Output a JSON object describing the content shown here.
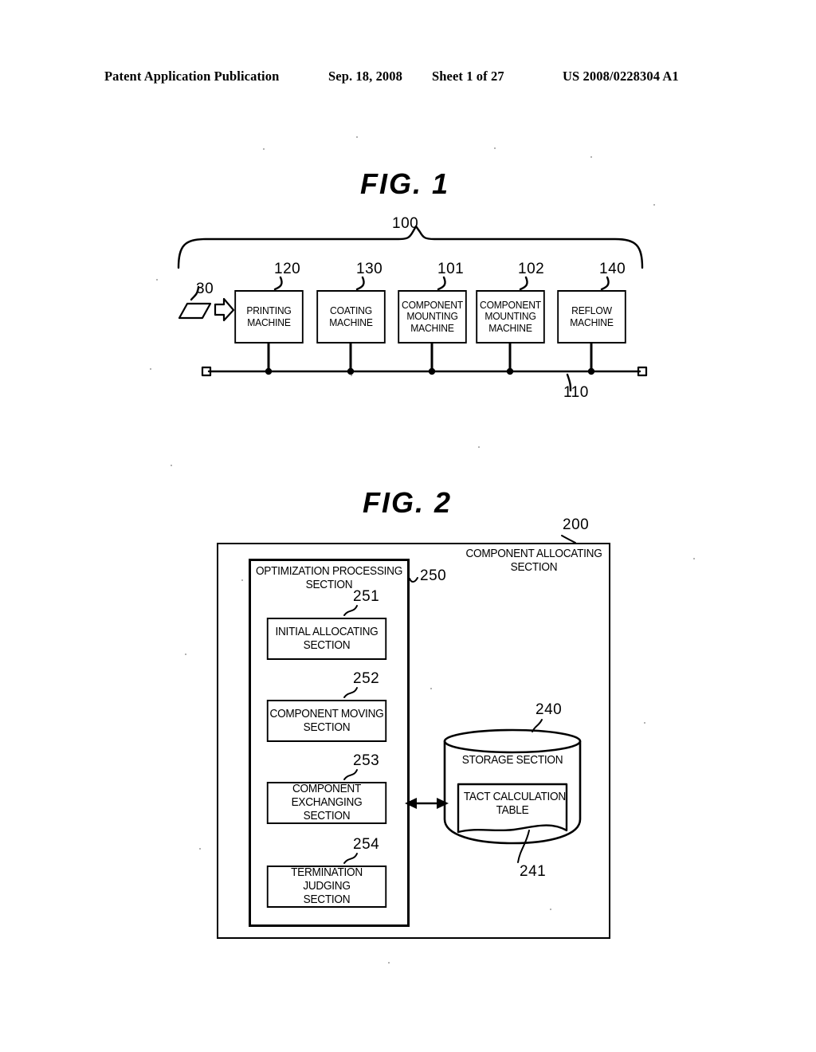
{
  "header": {
    "publication": "Patent Application Publication",
    "date": "Sep. 18, 2008",
    "sheet": "Sheet 1 of 27",
    "patent_number": "US 2008/0228304 A1"
  },
  "figures": [
    {
      "title": "FIG. 1",
      "system_ref": "100",
      "bus_ref": "110",
      "board_ref": "30",
      "machines": [
        {
          "ref": "120",
          "lines": [
            "PRINTING",
            "MACHINE"
          ]
        },
        {
          "ref": "130",
          "lines": [
            "COATING",
            "MACHINE"
          ]
        },
        {
          "ref": "101",
          "lines": [
            "COMPONENT",
            "MOUNTING",
            "MACHINE"
          ]
        },
        {
          "ref": "102",
          "lines": [
            "COMPONENT",
            "MOUNTING",
            "MACHINE"
          ]
        },
        {
          "ref": "140",
          "lines": [
            "REFLOW",
            "MACHINE"
          ]
        }
      ]
    },
    {
      "title": "FIG. 2",
      "outer": {
        "ref": "200",
        "lines": [
          "COMPONENT ALLOCATING",
          "SECTION"
        ]
      },
      "processing": {
        "ref": "250",
        "lines": [
          "OPTIMIZATION PROCESSING",
          "SECTION"
        ],
        "subsections": [
          {
            "ref": "251",
            "lines": [
              "INITIAL ALLOCATING",
              "SECTION"
            ]
          },
          {
            "ref": "252",
            "lines": [
              "COMPONENT MOVING",
              "SECTION"
            ]
          },
          {
            "ref": "253",
            "lines": [
              "COMPONENT",
              "EXCHANGING SECTION"
            ]
          },
          {
            "ref": "254",
            "lines": [
              "TERMINATION JUDGING",
              "SECTION"
            ]
          }
        ]
      },
      "storage": {
        "ref": "240",
        "label": "STORAGE SECTION",
        "table": {
          "ref": "241",
          "lines": [
            "TACT CALCULATION",
            "TABLE"
          ]
        }
      }
    }
  ]
}
